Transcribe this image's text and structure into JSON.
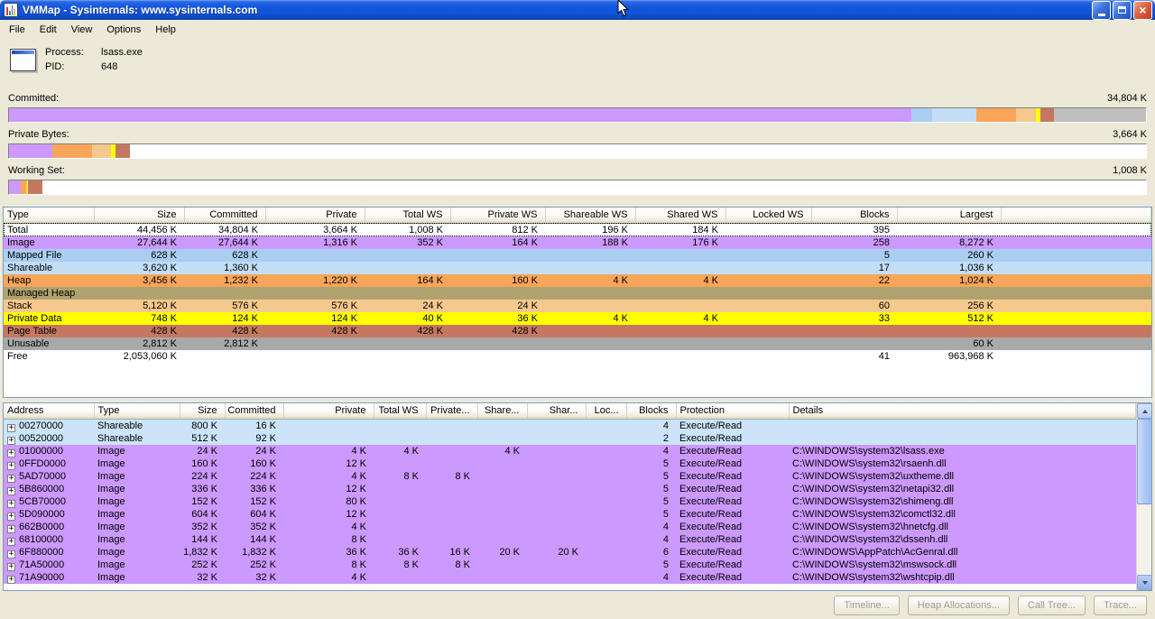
{
  "window": {
    "title": "VMMap - Sysinternals: www.sysinternals.com"
  },
  "menu": {
    "items": [
      "File",
      "Edit",
      "View",
      "Options",
      "Help"
    ]
  },
  "process": {
    "label": "Process:",
    "name": "lsass.exe",
    "pid_label": "PID:",
    "pid": "648"
  },
  "bars": [
    {
      "label": "Committed:",
      "value": "34,804 K",
      "segments": [
        {
          "type": "image",
          "color": "#CC99FF",
          "pct": 79.4
        },
        {
          "type": "mapped-file",
          "color": "#A9CEF2",
          "pct": 1.8
        },
        {
          "type": "shareable",
          "color": "#C3DDF5",
          "pct": 3.9
        },
        {
          "type": "heap",
          "color": "#F9A55A",
          "pct": 3.5
        },
        {
          "type": "stack",
          "color": "#F5C88E",
          "pct": 1.7
        },
        {
          "type": "private-data",
          "color": "#FFFF00",
          "pct": 0.4
        },
        {
          "type": "page-table",
          "color": "#C47862",
          "pct": 1.2
        },
        {
          "type": "unusable",
          "color": "#BFBFBF",
          "pct": 8.1
        }
      ]
    },
    {
      "label": "Private Bytes:",
      "value": "3,664 K",
      "segments": [
        {
          "type": "image",
          "color": "#CC99FF",
          "pct": 3.8
        },
        {
          "type": "heap",
          "color": "#F9A55A",
          "pct": 3.5
        },
        {
          "type": "stack",
          "color": "#F5C88E",
          "pct": 1.7
        },
        {
          "type": "private-data",
          "color": "#FFFF00",
          "pct": 0.4
        },
        {
          "type": "page-table",
          "color": "#C47862",
          "pct": 1.2
        }
      ]
    },
    {
      "label": "Working Set:",
      "value": "1,008 K",
      "segments": [
        {
          "type": "image",
          "color": "#CC99FF",
          "pct": 1.0
        },
        {
          "type": "heap",
          "color": "#F9A55A",
          "pct": 0.5
        },
        {
          "type": "stack",
          "color": "#F5C88E",
          "pct": 0.1
        },
        {
          "type": "private-data",
          "color": "#FFFF00",
          "pct": 0.1
        },
        {
          "type": "page-table",
          "color": "#C47862",
          "pct": 1.2
        }
      ]
    }
  ],
  "summary": {
    "columns": [
      "Type",
      "Size",
      "Committed",
      "Private",
      "Total WS",
      "Private WS",
      "Shareable WS",
      "Shared WS",
      "Locked WS",
      "Blocks",
      "Largest"
    ],
    "rows": [
      {
        "label": "Total",
        "color": "#FFFFFF",
        "focused": true,
        "cells": [
          "44,456 K",
          "34,804 K",
          "3,664 K",
          "1,008 K",
          "812 K",
          "196 K",
          "184 K",
          "",
          "395",
          ""
        ]
      },
      {
        "label": "Image",
        "color": "#CC99FF",
        "cells": [
          "27,644 K",
          "27,644 K",
          "1,316 K",
          "352 K",
          "164 K",
          "188 K",
          "176 K",
          "",
          "258",
          "8,272 K"
        ]
      },
      {
        "label": "Mapped File",
        "color": "#A9CEF2",
        "cells": [
          "628 K",
          "628 K",
          "",
          "",
          "",
          "",
          "",
          "",
          "5",
          "260 K"
        ]
      },
      {
        "label": "Shareable",
        "color": "#C3DDF5",
        "cells": [
          "3,620 K",
          "1,360 K",
          "",
          "",
          "",
          "",
          "",
          "",
          "17",
          "1,036 K"
        ]
      },
      {
        "label": "Heap",
        "color": "#F9A55A",
        "cells": [
          "3,456 K",
          "1,232 K",
          "1,220 K",
          "164 K",
          "160 K",
          "4 K",
          "4 K",
          "",
          "22",
          "1,024 K"
        ]
      },
      {
        "label": "Managed Heap",
        "color": "#B0A26F",
        "cells": [
          "",
          "",
          "",
          "",
          "",
          "",
          "",
          "",
          "",
          ""
        ]
      },
      {
        "label": "Stack",
        "color": "#F5C88E",
        "cells": [
          "5,120 K",
          "576 K",
          "576 K",
          "24 K",
          "24 K",
          "",
          "",
          "",
          "60",
          "256 K"
        ]
      },
      {
        "label": "Private Data",
        "color": "#FFFF00",
        "cells": [
          "748 K",
          "124 K",
          "124 K",
          "40 K",
          "36 K",
          "4 K",
          "4 K",
          "",
          "33",
          "512 K"
        ]
      },
      {
        "label": "Page Table",
        "color": "#C47862",
        "cells": [
          "428 K",
          "428 K",
          "428 K",
          "428 K",
          "428 K",
          "",
          "",
          "",
          "",
          ""
        ]
      },
      {
        "label": "Unusable",
        "color": "#A9A9A9",
        "cells": [
          "2,812 K",
          "2,812 K",
          "",
          "",
          "",
          "",
          "",
          "",
          "",
          "60 K"
        ]
      },
      {
        "label": "Free",
        "color": "#FFFFFF",
        "cells": [
          "2,053,060 K",
          "",
          "",
          "",
          "",
          "",
          "",
          "",
          "41",
          "963,968 K"
        ]
      }
    ]
  },
  "detail": {
    "columns": [
      "Address",
      "Type",
      "Size",
      "Committed",
      "Private",
      "Total WS",
      "Private...",
      "Share...",
      "Shar...",
      "Loc...",
      "Blocks",
      "Protection",
      "Details"
    ],
    "rows": [
      {
        "address": "00270000",
        "color": "#CBE4FA",
        "cells": [
          "Shareable",
          "800 K",
          "16 K",
          "",
          "",
          "",
          "",
          "",
          "",
          "4",
          "Execute/Read",
          ""
        ]
      },
      {
        "address": "00520000",
        "color": "#CBE4FA",
        "cells": [
          "Shareable",
          "512 K",
          "92 K",
          "",
          "",
          "",
          "",
          "",
          "",
          "2",
          "Execute/Read",
          ""
        ]
      },
      {
        "address": "01000000",
        "color": "#CC99FF",
        "cells": [
          "Image",
          "24 K",
          "24 K",
          "4 K",
          "4 K",
          "",
          "4 K",
          "",
          "",
          "4",
          "Execute/Read",
          "C:\\WINDOWS\\system32\\lsass.exe"
        ]
      },
      {
        "address": "0FFD0000",
        "color": "#CC99FF",
        "cells": [
          "Image",
          "160 K",
          "160 K",
          "12 K",
          "",
          "",
          "",
          "",
          "",
          "5",
          "Execute/Read",
          "C:\\WINDOWS\\system32\\rsaenh.dll"
        ]
      },
      {
        "address": "5AD70000",
        "color": "#CC99FF",
        "cells": [
          "Image",
          "224 K",
          "224 K",
          "4 K",
          "8 K",
          "8 K",
          "",
          "",
          "",
          "5",
          "Execute/Read",
          "C:\\WINDOWS\\system32\\uxtheme.dll"
        ]
      },
      {
        "address": "5B860000",
        "color": "#CC99FF",
        "cells": [
          "Image",
          "336 K",
          "336 K",
          "12 K",
          "",
          "",
          "",
          "",
          "",
          "5",
          "Execute/Read",
          "C:\\WINDOWS\\system32\\netapi32.dll"
        ]
      },
      {
        "address": "5CB70000",
        "color": "#CC99FF",
        "cells": [
          "Image",
          "152 K",
          "152 K",
          "80 K",
          "",
          "",
          "",
          "",
          "",
          "5",
          "Execute/Read",
          "C:\\WINDOWS\\system32\\shimeng.dll"
        ]
      },
      {
        "address": "5D090000",
        "color": "#CC99FF",
        "cells": [
          "Image",
          "604 K",
          "604 K",
          "12 K",
          "",
          "",
          "",
          "",
          "",
          "5",
          "Execute/Read",
          "C:\\WINDOWS\\system32\\comctl32.dll"
        ]
      },
      {
        "address": "662B0000",
        "color": "#CC99FF",
        "cells": [
          "Image",
          "352 K",
          "352 K",
          "4 K",
          "",
          "",
          "",
          "",
          "",
          "4",
          "Execute/Read",
          "C:\\WINDOWS\\system32\\hnetcfg.dll"
        ]
      },
      {
        "address": "68100000",
        "color": "#CC99FF",
        "cells": [
          "Image",
          "144 K",
          "144 K",
          "8 K",
          "",
          "",
          "",
          "",
          "",
          "4",
          "Execute/Read",
          "C:\\WINDOWS\\system32\\dssenh.dll"
        ]
      },
      {
        "address": "6F880000",
        "color": "#CC99FF",
        "cells": [
          "Image",
          "1,832 K",
          "1,832 K",
          "36 K",
          "36 K",
          "16 K",
          "20 K",
          "20 K",
          "",
          "6",
          "Execute/Read",
          "C:\\WINDOWS\\AppPatch\\AcGenral.dll"
        ]
      },
      {
        "address": "71A50000",
        "color": "#CC99FF",
        "cells": [
          "Image",
          "252 K",
          "252 K",
          "8 K",
          "8 K",
          "8 K",
          "",
          "",
          "",
          "5",
          "Execute/Read",
          "C:\\WINDOWS\\system32\\mswsock.dll"
        ]
      },
      {
        "address": "71A90000",
        "color": "#CC99FF",
        "cells": [
          "Image",
          "32 K",
          "32 K",
          "4 K",
          "",
          "",
          "",
          "",
          "",
          "4",
          "Execute/Read",
          "C:\\WINDOWS\\system32\\wshtcpip.dll"
        ]
      }
    ]
  },
  "footer": {
    "buttons": [
      "Timeline...",
      "Heap Allocations...",
      "Call Tree...",
      "Trace..."
    ]
  },
  "icon_colors": {
    "bar1": "#D04040",
    "bar2": "#40A040",
    "bar3": "#4060D0",
    "bar4": "#E0C040"
  }
}
